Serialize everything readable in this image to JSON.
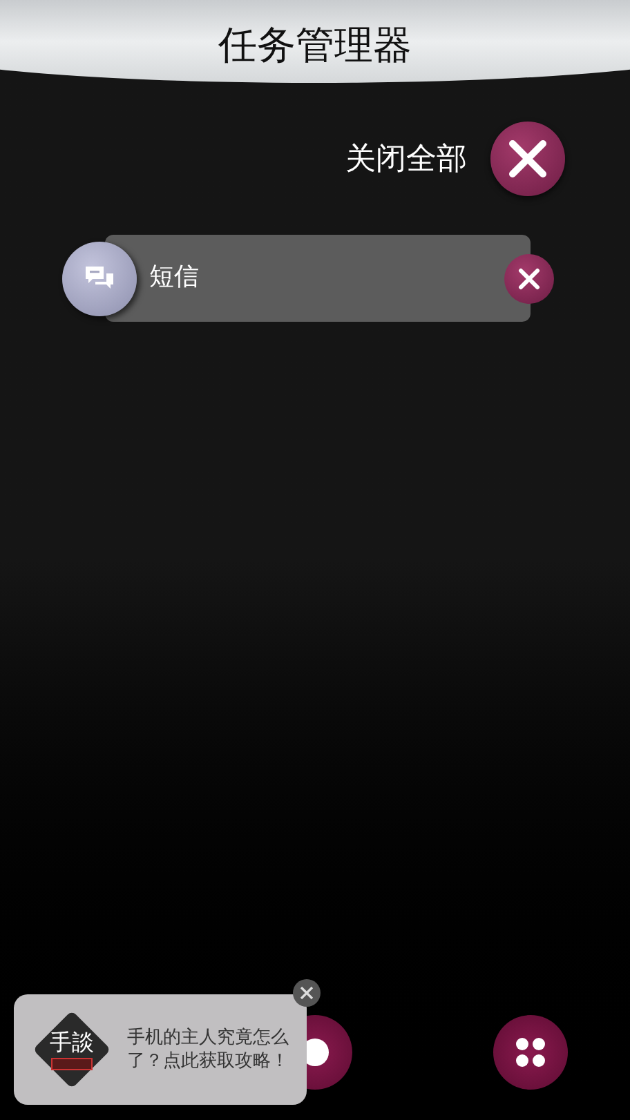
{
  "header": {
    "title": "任务管理器"
  },
  "close_all": {
    "label": "关闭全部"
  },
  "tasks": [
    {
      "label": "短信",
      "kind": "messages"
    }
  ],
  "popup": {
    "logo_text": "手談",
    "message": "手机的主人究竟怎么了？点此获取攻略！"
  }
}
